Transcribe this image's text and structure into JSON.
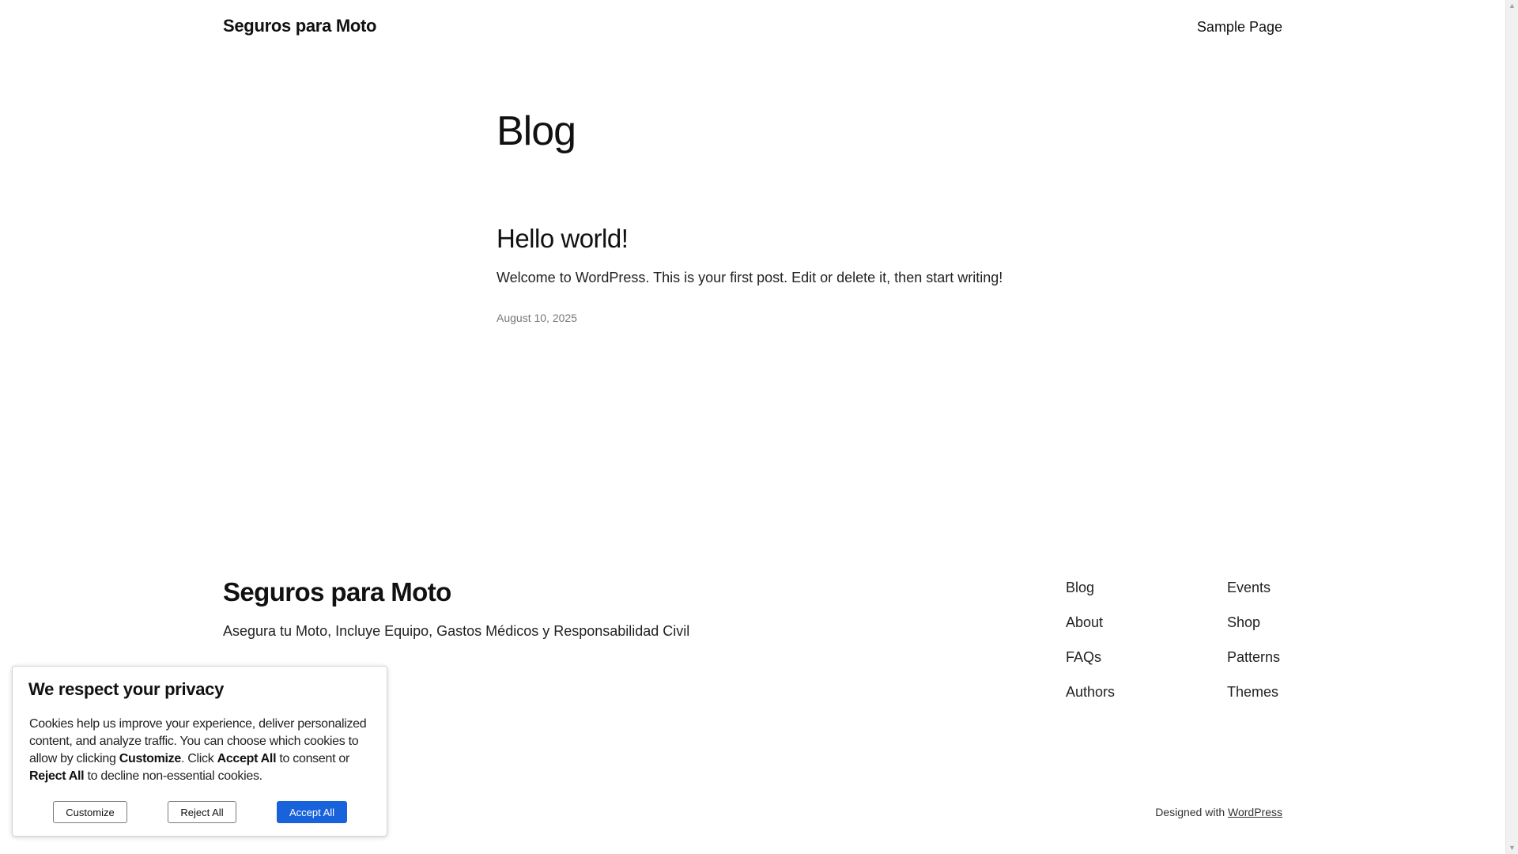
{
  "header": {
    "site_title": "Seguros para Moto",
    "nav": [
      "Sample Page"
    ]
  },
  "main": {
    "page_title": "Blog",
    "posts": [
      {
        "title": "Hello world!",
        "excerpt": "Welcome to WordPress. This is your first post. Edit or delete it, then start writing!",
        "date": "August 10, 2025"
      }
    ]
  },
  "footer": {
    "site_title": "Seguros para Moto",
    "tagline": "Asegura tu Moto, Incluye Equipo, Gastos Médicos y Responsabilidad Civil",
    "nav_col1": [
      "Blog",
      "About",
      "FAQs",
      "Authors"
    ],
    "nav_col2": [
      "Events",
      "Shop",
      "Patterns",
      "Themes"
    ],
    "credit_prefix": "Designed with",
    "credit_link": "WordPress"
  },
  "cookie_banner": {
    "title": "We respect your privacy",
    "text_1": "Cookies help us improve your experience, deliver personalized content, and analyze traffic. You can choose which cookies to allow by clicking ",
    "customize_word": "Customize",
    "text_2": ". Click ",
    "accept_word": "Accept All",
    "text_3": " to consent or ",
    "reject_word": "Reject All",
    "text_4": " to decline non-essential cookies.",
    "buttons": {
      "customize": "Customize",
      "reject": "Reject All",
      "accept": "Accept All"
    },
    "accent_color": "#1863dc"
  },
  "scrollbar": {
    "up_icon": "triangle-up",
    "down_icon": "triangle-down"
  }
}
